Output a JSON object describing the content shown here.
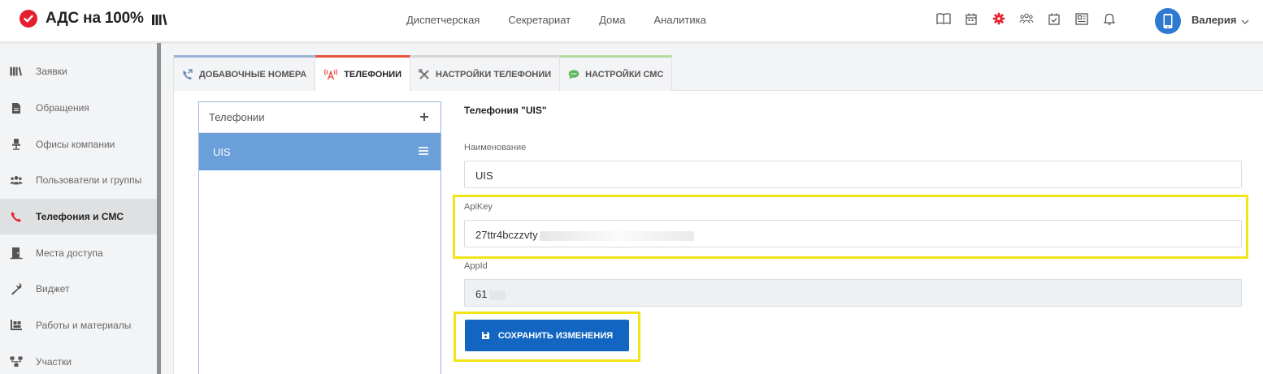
{
  "app": {
    "logo_text": "АДС на 100%"
  },
  "topnav": [
    "Диспетчерская",
    "Секретариат",
    "Дома",
    "Аналитика"
  ],
  "header_icons": [
    "book-icon",
    "calendar-icon",
    "settings-gear-icon",
    "users-group-icon",
    "calendar-check-icon",
    "newspaper-icon",
    "bell-icon"
  ],
  "user": {
    "name": "Валерия"
  },
  "sidebar": {
    "items": [
      {
        "label": "Заявки",
        "icon": "library-icon",
        "active": false
      },
      {
        "label": "Обращения",
        "icon": "document-icon",
        "active": false
      },
      {
        "label": "Офисы компании",
        "icon": "office-chair-icon",
        "active": false
      },
      {
        "label": "Пользователи и группы",
        "icon": "users-icon",
        "active": false
      },
      {
        "label": "Телефония и СМС",
        "icon": "phone-icon",
        "active": true
      },
      {
        "label": "Места доступа",
        "icon": "door-icon",
        "active": false
      },
      {
        "label": "Виджет",
        "icon": "wrench-icon",
        "active": false
      },
      {
        "label": "Работы и материалы",
        "icon": "pallet-icon",
        "active": false
      },
      {
        "label": "Участки",
        "icon": "sitemap-icon",
        "active": false
      }
    ]
  },
  "tabs": [
    {
      "label": "ДОБАВОЧНЫЕ НОМЕРА",
      "icon": "phone-forward-icon"
    },
    {
      "label": "ТЕЛЕФОНИИ",
      "icon": "antenna-icon",
      "active": true
    },
    {
      "label": "НАСТРОЙКИ ТЕЛЕФОНИИ",
      "icon": "tools-icon"
    },
    {
      "label": "НАСТРОЙКИ СМС",
      "icon": "chat-bubble-icon"
    }
  ],
  "list": {
    "title": "Телефонии",
    "items": [
      {
        "label": "UIS"
      }
    ]
  },
  "form": {
    "title": "Телефония \"UIS\"",
    "name_label": "Наименование",
    "name_value": "UIS",
    "apikey_label": "ApiKey",
    "apikey_value": "27ttr4bczzvty",
    "appid_label": "AppId",
    "appid_value": "61",
    "save_label": "СОХРАНИТЬ ИЗМЕНЕНИЯ"
  },
  "colors": {
    "brand_red": "#e5202e",
    "active_accent": "#e5533e",
    "list_selected": "#6a9fd9",
    "primary_button": "#1266c2",
    "highlight": "#f2e415"
  }
}
